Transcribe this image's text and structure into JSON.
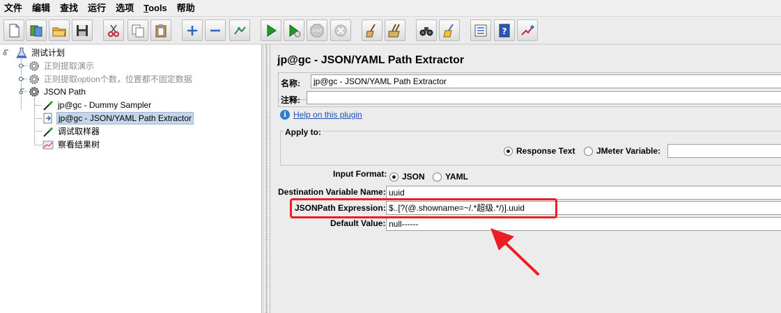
{
  "menu": [
    {
      "label": "文件"
    },
    {
      "label": "编辑"
    },
    {
      "label": "查找"
    },
    {
      "label": "运行"
    },
    {
      "label": "选项"
    },
    {
      "label_u": "T",
      "label_rest": "ools"
    },
    {
      "label": "帮助"
    }
  ],
  "toolbar": {
    "buttons": [
      "new-icon",
      "templates-icon",
      "open-icon",
      "save-icon",
      "cut-icon",
      "copy-icon",
      "paste-icon",
      "expand-icon",
      "collapse-icon",
      "toggle-icon",
      "start-icon",
      "start-no-pause-icon",
      "stop-icon",
      "shutdown-icon",
      "clear-icon",
      "clear-all-icon",
      "search-icon",
      "reset-search-icon",
      "function-helper-icon",
      "help-icon",
      "remote-icon"
    ]
  },
  "tree": {
    "root": "测试计划",
    "items": [
      {
        "label": "正则提取演示",
        "disabled": true
      },
      {
        "label": "正则提取option个数，位置都不固定数据",
        "disabled": true
      },
      {
        "label": "JSON Path",
        "disabled": false
      }
    ],
    "children": [
      {
        "label": "jp@gc - Dummy Sampler"
      },
      {
        "label": "jp@gc - JSON/YAML Path Extractor",
        "selected": true
      },
      {
        "label": "调试取样器"
      },
      {
        "label": "察看结果树"
      }
    ]
  },
  "panel": {
    "title": "jp@gc - JSON/YAML Path Extractor",
    "name_label": "名称:",
    "name_value": "jp@gc - JSON/YAML Path Extractor",
    "comment_label": "注释:",
    "comment_value": "",
    "help_link": "Help on this plugin",
    "apply_to": {
      "legend": "Apply to:",
      "response_text": "Response Text",
      "jmeter_variable": "JMeter Variable:",
      "jmeter_variable_value": "",
      "selected": "response_text"
    },
    "input_format": {
      "label": "Input Format:",
      "json": "JSON",
      "yaml": "YAML",
      "selected": "json"
    },
    "dest_var": {
      "label": "Destination Variable Name:",
      "value": "uuid"
    },
    "jsonpath": {
      "label": "JSONPath Expression:",
      "value": "$..[?(@.showname=~/.*超级.*/)].uuid"
    },
    "default_value": {
      "label": "Default Value:",
      "value": "null------"
    }
  },
  "colors": {
    "highlight_border": "#ee1c24",
    "selection": "#c3d6ea",
    "link": "#1f4fb3"
  }
}
